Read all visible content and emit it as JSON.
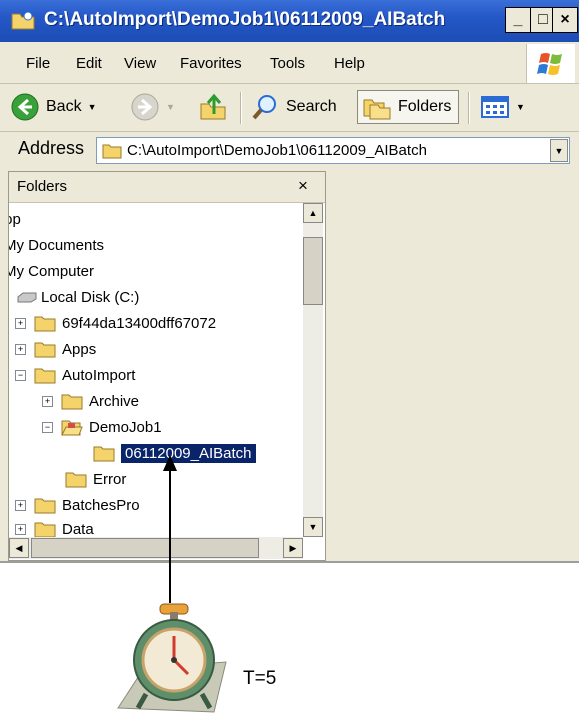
{
  "window": {
    "title_main": "C:\\AutoImport\\DemoJob1\\06112009_AIBatch",
    "controls": {
      "minimize": "_",
      "maximize": "□",
      "close": "×"
    }
  },
  "menu": [
    "File",
    "Edit",
    "View",
    "Favorites",
    "Tools",
    "Help"
  ],
  "toolbar": {
    "back_label": "Back",
    "search_label": "Search",
    "folders_label": "Folders"
  },
  "address": {
    "label": "Address",
    "value": "C:\\AutoImport\\DemoJob1\\06112009_AIBatch"
  },
  "folders_pane": {
    "title": "Folders",
    "close": "×",
    "items": [
      {
        "label": "top"
      },
      {
        "label": "My Documents"
      },
      {
        "label": "My Computer"
      },
      {
        "label": "Local Disk (C:)"
      },
      {
        "label": "69f44da13400dff67072"
      },
      {
        "label": "Apps"
      },
      {
        "label": "AutoImport"
      },
      {
        "label": "Archive"
      },
      {
        "label": "DemoJob1"
      },
      {
        "label": "06112009_AIBatch",
        "selected": true
      },
      {
        "label": "Error"
      },
      {
        "label": "BatchesPro"
      },
      {
        "label": "Data"
      }
    ]
  },
  "annotation": {
    "label": "T=5"
  },
  "icons": {
    "app": "folder-explorer-icon",
    "back": "back-arrow-icon",
    "forward": "forward-arrow-icon",
    "up": "folder-up-icon",
    "search": "magnifier-icon",
    "folders": "folders-icon",
    "views": "views-icon",
    "folder": "folder-icon",
    "clock": "alarm-clock-icon"
  },
  "colors": {
    "title_bar": "#2458c8",
    "selection": "#0a246a",
    "chrome": "#ece9d8",
    "folder": "#f5d36b"
  }
}
